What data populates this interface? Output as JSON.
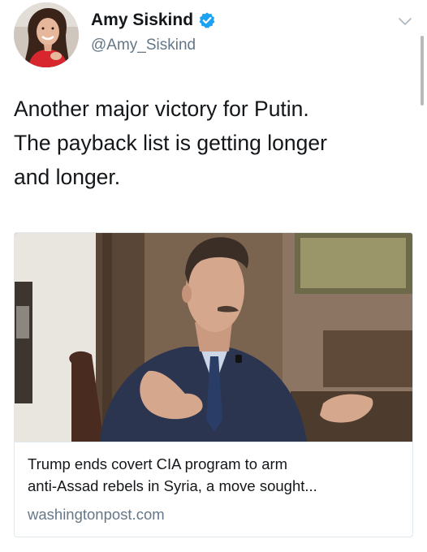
{
  "author": {
    "display_name": "Amy Siskind",
    "handle": "@Amy_Siskind",
    "verified": true,
    "verified_icon": "verified-badge-icon",
    "verified_color": "#1da1f2"
  },
  "tweet": {
    "text_lines": [
      "Another major victory for Putin.",
      "The payback list is getting longer",
      "and longer."
    ]
  },
  "card": {
    "title_lines": [
      "Trump ends covert CIA program to arm",
      "anti-Assad rebels in Syria, a move sought..."
    ],
    "domain": "washingtonpost.com"
  },
  "menu": {
    "icon": "chevron-down-icon"
  },
  "colors": {
    "text": "#14171a",
    "secondary": "#657786",
    "border": "#e1e8ed"
  }
}
